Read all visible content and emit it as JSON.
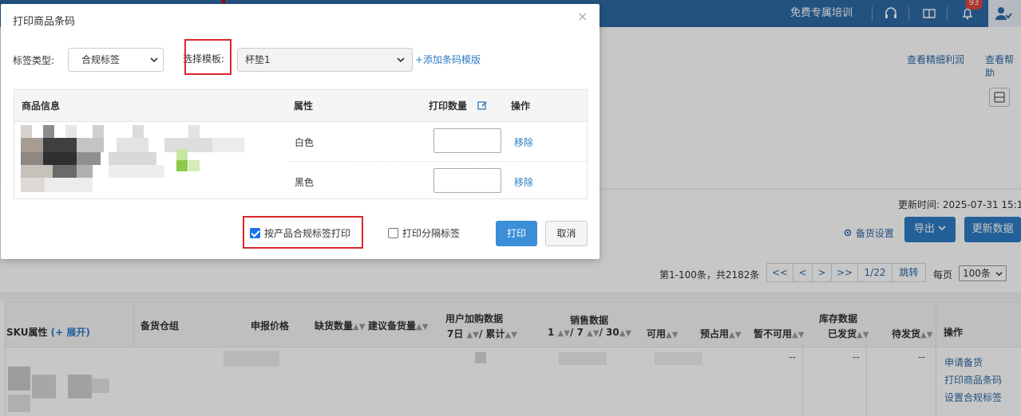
{
  "topbar": {
    "training": "免费专属培训",
    "notification_count": "93"
  },
  "background": {
    "links_right": [
      "查看精细利润",
      "查看帮助"
    ],
    "update_time": "更新时间: 2025-07-31 15:1",
    "stock_settings": "备货设置",
    "export_label": "导出",
    "refresh_label": "更新数据",
    "pager": {
      "summary": "第1-100条，共2182条",
      "first": "<<",
      "prev": "<",
      "next": ">",
      "last": ">>",
      "page": "1/22",
      "jump": "跳转",
      "per_page_label": "每页",
      "per_page_value": "100条"
    },
    "table_headers": {
      "sku": "SKU属性",
      "expand": "(+ 展开)",
      "warehouse": "备货仓组",
      "declared_price": "申报价格",
      "shortage": "缺货数量",
      "suggested": "建议备货量",
      "user_cart": "用户加购数据",
      "user_cart_sub": "7日",
      "user_cart_sub2": "/ 累计",
      "sales": "销售数据",
      "sales_sub": "1",
      "sales_sub2": "/ 7",
      "sales_sub3": "/ 30",
      "available": "可用",
      "reserved": "预占用",
      "unavailable": "暂不可用",
      "inventory": "库存数据",
      "shipped": "已发货",
      "pending": "待发货",
      "actions": "操作"
    },
    "row_dashes": [
      "--",
      "--",
      "--"
    ],
    "row_actions": [
      "申请备货",
      "打印商品条码",
      "设置合规标签"
    ]
  },
  "modal": {
    "title": "打印商品条码",
    "close": "×",
    "label_type_label": "标签类型:",
    "label_type_value": "合规标签",
    "template_label": "选择模板:",
    "template_value": "杯垫1",
    "add_template": "+添加条码模版",
    "table": {
      "headers": [
        "商品信息",
        "属性",
        "打印数量",
        "操作"
      ],
      "rows": [
        {
          "attribute": "白色",
          "quantity": "",
          "action": "移除"
        },
        {
          "attribute": "黑色",
          "quantity": "",
          "action": "移除"
        }
      ]
    },
    "checkbox_compliance": {
      "label": "按产品合规标签打印",
      "checked": true
    },
    "checkbox_separator": {
      "label": "打印分隔标签",
      "checked": false
    },
    "print_button": "打印",
    "cancel_button": "取消"
  }
}
